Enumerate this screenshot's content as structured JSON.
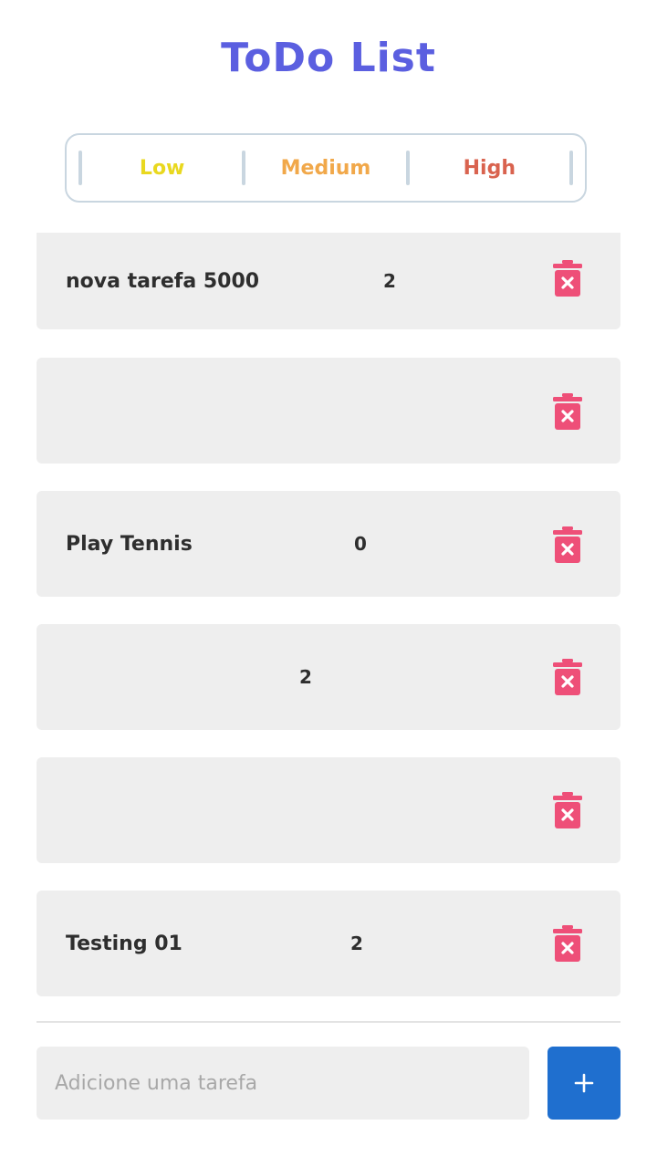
{
  "app": {
    "title": "ToDo List"
  },
  "priorities": [
    {
      "label": "Low",
      "color": "#e9d81f"
    },
    {
      "label": "Medium",
      "color": "#f1a84a"
    },
    {
      "label": "High",
      "color": "#d9634f"
    }
  ],
  "tasks": [
    {
      "name": "nova tarefa 5000",
      "priority": "2"
    },
    {
      "name": "",
      "priority": ""
    },
    {
      "name": "Play Tennis",
      "priority": "0"
    },
    {
      "name": "",
      "priority": "2"
    },
    {
      "name": "",
      "priority": ""
    },
    {
      "name": "Testing 01",
      "priority": "2"
    }
  ],
  "input": {
    "placeholder": "Adicione uma tarefa",
    "value": ""
  },
  "icons": {
    "delete": "trash-x-icon",
    "add": "plus-icon"
  },
  "colors": {
    "title": "#5b5fe0",
    "delete": "#ee4f78",
    "add_button": "#1f6fcf",
    "card": "#eeeeee"
  }
}
